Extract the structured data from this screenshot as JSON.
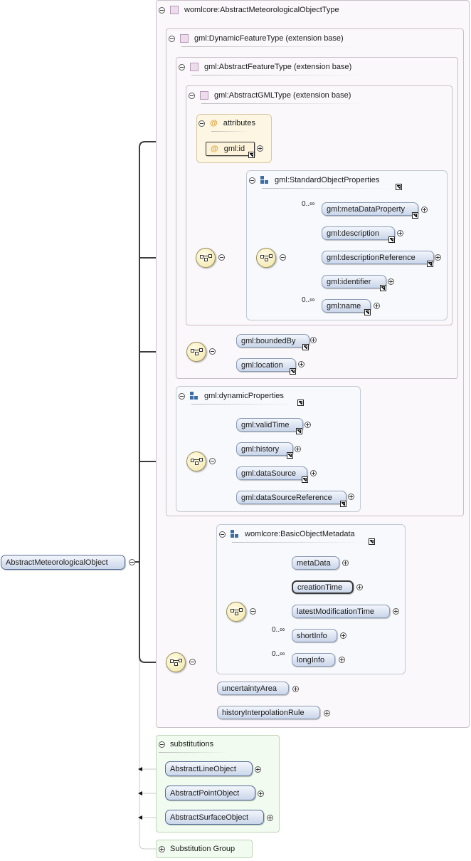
{
  "root": "AbstractMeteorologicalObject",
  "types": {
    "outer": "womlcore:AbstractMeteorologicalObjectType",
    "dynamic_feature": "gml:DynamicFeatureType (extension base)",
    "abstract_feature": "gml:AbstractFeatureType (extension base)",
    "abstract_gml": "gml:AbstractGMLType (extension base)"
  },
  "attributes": {
    "title": "attributes",
    "id": "gml:id"
  },
  "standard_object_properties": {
    "title": "gml:StandardObjectProperties",
    "items": [
      {
        "label": "gml:metaDataProperty",
        "cardinality": "0..∞"
      },
      {
        "label": "gml:description",
        "cardinality": ""
      },
      {
        "label": "gml:descriptionReference",
        "cardinality": ""
      },
      {
        "label": "gml:identifier",
        "cardinality": ""
      },
      {
        "label": "gml:name",
        "cardinality": "0..∞"
      }
    ]
  },
  "feature_items": [
    "gml:boundedBy",
    "gml:location"
  ],
  "dynamic_properties": {
    "title": "gml:dynamicProperties",
    "items": [
      "gml:validTime",
      "gml:history",
      "gml:dataSource",
      "gml:dataSourceReference"
    ]
  },
  "basic_object_metadata": {
    "title": "womlcore:BasicObjectMetadata",
    "items": [
      {
        "label": "metaData",
        "cardinality": ""
      },
      {
        "label": "creationTime",
        "cardinality": ""
      },
      {
        "label": "latestModificationTime",
        "cardinality": ""
      },
      {
        "label": "shortInfo",
        "cardinality": "0..∞"
      },
      {
        "label": "longInfo",
        "cardinality": "0..∞"
      }
    ]
  },
  "extra_items": [
    "uncertaintyArea",
    "historyInterpolationRule"
  ],
  "substitutions": {
    "title": "substitutions",
    "items": [
      "AbstractLineObject",
      "AbstractPointObject",
      "AbstractSurfaceObject"
    ]
  },
  "substitution_group": "Substitution Group"
}
